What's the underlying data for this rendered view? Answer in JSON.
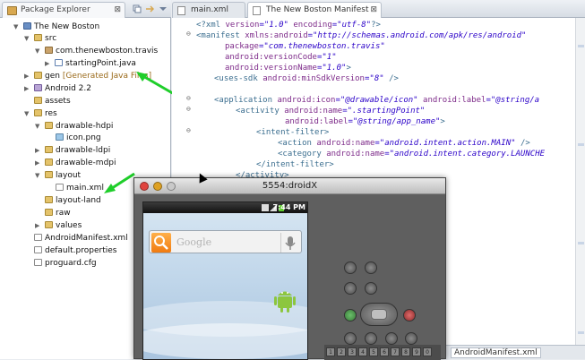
{
  "package_explorer": {
    "title": "Package Explorer",
    "close_symbol": "⊠",
    "tree": [
      {
        "label": "The New Boston",
        "icon": "project-icon"
      },
      {
        "label": "src",
        "icon": "folder-icon"
      },
      {
        "label": "com.thenewboston.travis",
        "icon": "package-icon"
      },
      {
        "label": "startingPoint.java",
        "icon": "java-file-icon"
      },
      {
        "label": "gen",
        "note": "[Generated Java Files]",
        "icon": "folder-icon"
      },
      {
        "label": "Android 2.2",
        "icon": "library-icon"
      },
      {
        "label": "assets",
        "icon": "folder-icon"
      },
      {
        "label": "res",
        "icon": "folder-icon"
      },
      {
        "label": "drawable-hdpi",
        "icon": "folder-icon"
      },
      {
        "label": "icon.png",
        "icon": "image-file-icon"
      },
      {
        "label": "drawable-ldpi",
        "icon": "folder-icon"
      },
      {
        "label": "drawable-mdpi",
        "icon": "folder-icon"
      },
      {
        "label": "layout",
        "icon": "folder-icon"
      },
      {
        "label": "main.xml",
        "icon": "xml-file-icon"
      },
      {
        "label": "layout-land",
        "icon": "folder-icon"
      },
      {
        "label": "raw",
        "icon": "folder-icon"
      },
      {
        "label": "values",
        "icon": "folder-icon"
      },
      {
        "label": "AndroidManifest.xml",
        "icon": "xml-file-icon"
      },
      {
        "label": "default.properties",
        "icon": "file-icon"
      },
      {
        "label": "proguard.cfg",
        "icon": "file-icon"
      }
    ]
  },
  "editor": {
    "tabs": [
      {
        "label": "main.xml"
      },
      {
        "label": "The New Boston Manifest",
        "close": "⊠"
      }
    ],
    "code": {
      "l1": {
        "t1": "<?xml ",
        "a1": "version",
        "v1": "=\"1.0\"",
        "a2": " encoding",
        "v2": "=\"utf-8\"",
        "t2": "?>"
      },
      "l2": {
        "t1": "<manifest ",
        "a1": "xmlns:android",
        "v1": "=\"http://schemas.android.com/apk/res/android\""
      },
      "l3": {
        "a1": "package",
        "v1": "=\"com.thenewboston.travis\""
      },
      "l4": {
        "a1": "android:versionCode",
        "v1": "=\"1\""
      },
      "l5": {
        "a1": "android:versionName",
        "v1": "=\"1.0\"",
        "t1": ">"
      },
      "l6": {
        "t1": "<uses-sdk ",
        "a1": "android:minSdkVersion",
        "v1": "=\"8\"",
        "t2": " />"
      },
      "l7": {
        "t1": "<application ",
        "a1": "android:icon",
        "v1": "=\"@drawable/icon\"",
        "a2": " android:label",
        "v2": "=\"@string/a"
      },
      "l8": {
        "t1": "<activity ",
        "a1": "android:name",
        "v1": "=\".startingPoint\""
      },
      "l9": {
        "a1": "android:label",
        "v1": "=\"@string/app_name\"",
        "t1": ">"
      },
      "l10": {
        "t1": "<intent-filter>"
      },
      "l11": {
        "t1": "<action ",
        "a1": "android:name",
        "v1": "=\"android.intent.action.MAIN\"",
        "t2": " />"
      },
      "l12": {
        "t1": "<category ",
        "a1": "android:name",
        "v1": "=\"android.intent.category.LAUNCHE"
      },
      "l13": {
        "t1": "</intent-filter>"
      },
      "l14": {
        "t1": "</activity>"
      }
    },
    "bottom_tab": "AndroidManifest.xml"
  },
  "emulator": {
    "title": "5554:droidX",
    "clock": "7:44 PM",
    "search_placeholder": "Google",
    "keys": [
      "1",
      "2",
      "3",
      "4",
      "5",
      "6",
      "7",
      "8",
      "9",
      "0"
    ]
  },
  "colors": {
    "annotation_arrow": "#1fce2a",
    "xml_tag": "#3b6e8f",
    "xml_attr": "#7d2a89",
    "xml_value": "#2a00c8"
  }
}
